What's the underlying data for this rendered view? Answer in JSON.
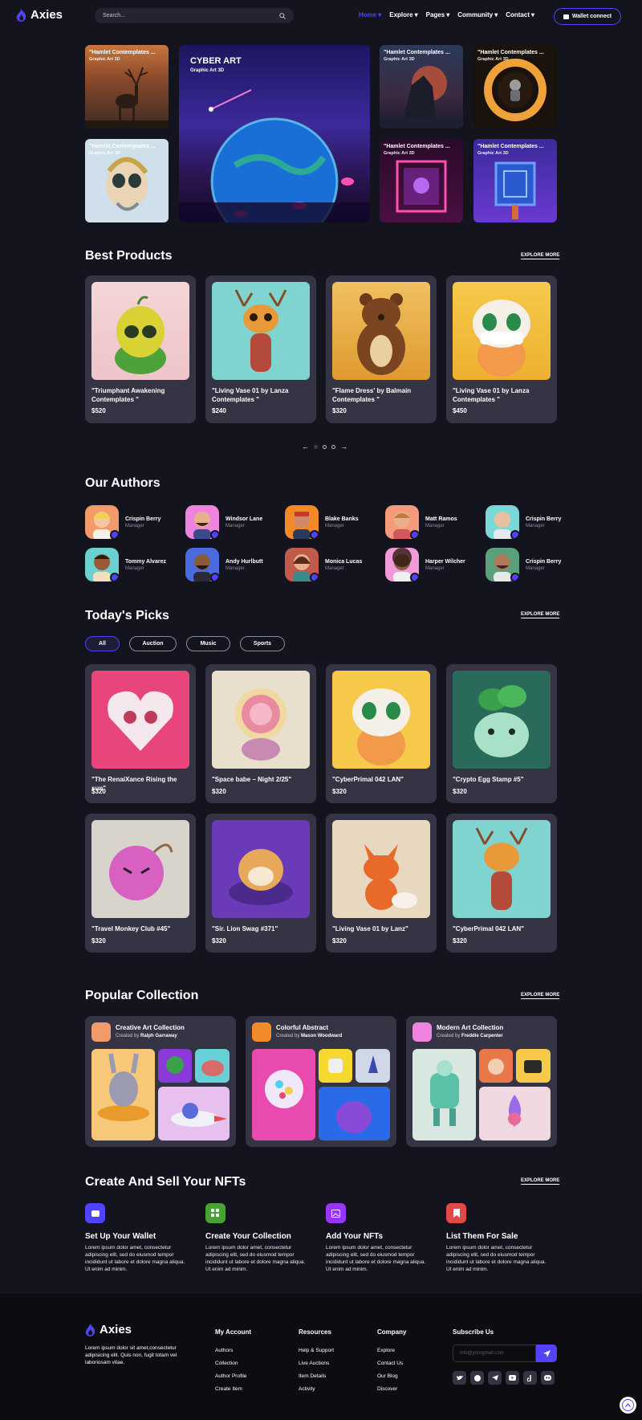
{
  "header": {
    "logo": "Axies",
    "search_placeholder": "Search...",
    "nav": [
      "Home",
      "Explore",
      "Pages",
      "Community",
      "Contact"
    ],
    "wallet": "Wallet connect"
  },
  "hero": {
    "main_title": "CYBER ART",
    "main_sub": "Graphic Art 3D",
    "card_title": "\"Hamlet Contemplates ...",
    "card_sub": "Graphic Art 3D"
  },
  "best_products": {
    "title": "Best Products",
    "explore": "EXPLORE MORE",
    "items": [
      {
        "name": "\"Triumphant Awakening Contemplates \"",
        "price": "$520"
      },
      {
        "name": "\"Living Vase 01 by Lanza Contemplates \"",
        "price": "$240"
      },
      {
        "name": "\"Flame Dress' by Balmain Contemplates \"",
        "price": "$320"
      },
      {
        "name": "\"Living Vase 01 by Lanza Contemplates \"",
        "price": "$450"
      }
    ]
  },
  "authors": {
    "title": "Our Authors",
    "items": [
      {
        "name": "Crispin Berry",
        "role": "Manager"
      },
      {
        "name": "Windsor Lane",
        "role": "Manager"
      },
      {
        "name": "Blake Banks",
        "role": "Manager"
      },
      {
        "name": "Matt Ramos",
        "role": "Manager"
      },
      {
        "name": "Crispin Berry",
        "role": "Manager"
      },
      {
        "name": "Tommy Alvarez",
        "role": "Manager"
      },
      {
        "name": "Andy Hurlbutt",
        "role": "Manager"
      },
      {
        "name": "Monica Lucas",
        "role": "Manager"
      },
      {
        "name": "Harper Wilcher",
        "role": "Manager"
      },
      {
        "name": "Crispin Berry",
        "role": "Manager"
      }
    ]
  },
  "picks": {
    "title": "Today's Picks",
    "explore": "EXPLORE MORE",
    "filters": [
      "All",
      "Auction",
      "Music",
      "Sports"
    ],
    "items": [
      {
        "name": "\"The RenaiXance Rising the sun\"",
        "price": "$320"
      },
      {
        "name": "\"Space babe – Night 2/25\"",
        "price": "$320"
      },
      {
        "name": "\"CyberPrimal 042 LAN\"",
        "price": "$320"
      },
      {
        "name": "\"Crypto Egg Stamp #5\"",
        "price": "$320"
      },
      {
        "name": "\"Travel Monkey Club #45\"",
        "price": "$320"
      },
      {
        "name": "\"Sir. Lion Swag #371\"",
        "price": "$320"
      },
      {
        "name": "\"Living Vase 01 by Lanz\"",
        "price": "$320"
      },
      {
        "name": "\"CyberPrimal 042 LAN\"",
        "price": "$320"
      }
    ]
  },
  "collection": {
    "title": "Popular Collection",
    "explore": "EXPLORE MORE",
    "created_by": "Created by",
    "items": [
      {
        "name": "Creative Art Collection",
        "author": "Ralph Garraway"
      },
      {
        "name": "Colorful Abstract",
        "author": "Mason Woodward"
      },
      {
        "name": "Modern Art Collection",
        "author": "Freddie Carpenter"
      }
    ]
  },
  "create": {
    "title": "Create And Sell Your NFTs",
    "explore": "EXPLORE MORE",
    "steps": [
      {
        "title": "Set Up Your Wallet",
        "color": "#5142fc"
      },
      {
        "title": "Create Your Collection",
        "color": "#47a432"
      },
      {
        "title": "Add Your NFTs",
        "color": "#9835fb"
      },
      {
        "title": "List Them For Sale",
        "color": "#df4949"
      }
    ],
    "text": "Lorem ipsum dolor amet, consectetur adipiscing elit, sed do eiusmod tempor incididunt ut labore et dolore magna aliqua. Ut enim ad minim."
  },
  "footer": {
    "logo": "Axies",
    "about": "Lorem ipsum dolor sit amet,consectetur adipisicing elit. Quis non, fugit totam vel laboriosam vitae.",
    "cols": [
      {
        "title": "My Account",
        "items": [
          "Authors",
          "Collection",
          "Author Profile",
          "Create Item"
        ]
      },
      {
        "title": "Resources",
        "items": [
          "Help & Support",
          "Live Auctions",
          "Item Details",
          "Activity"
        ]
      },
      {
        "title": "Company",
        "items": [
          "Explore",
          "Contact Us",
          "Our Blog",
          "Discover"
        ]
      }
    ],
    "subscribe_title": "Subscribe Us",
    "email_placeholder": "info@yourgmail.com"
  },
  "colors": {
    "accent": "#5142fc",
    "bg": "#14141f",
    "card": "#343444"
  }
}
